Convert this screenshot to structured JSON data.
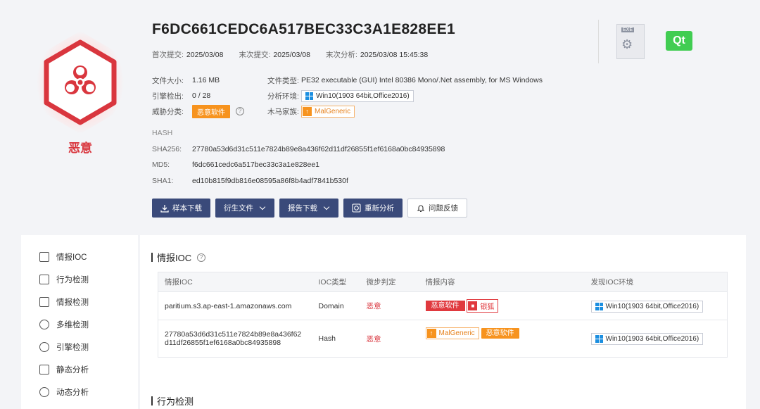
{
  "sample": {
    "hash_title": "F6DC661CEDC6A517BEC33C3A1E828EE1",
    "verdict": "恶意"
  },
  "dates": [
    {
      "label": "首次提交:",
      "value": "2025/03/08"
    },
    {
      "label": "末次提交:",
      "value": "2025/03/08"
    },
    {
      "label": "末次分析:",
      "value": "2025/03/08 15:45:38"
    }
  ],
  "info": {
    "file_size_label": "文件大小:",
    "file_size": "1.16 MB",
    "file_type_label": "文件类型:",
    "file_type": "PE32 executable (GUI) Intel 80386 Mono/.Net assembly, for MS Windows",
    "engine_label": "引擎检出:",
    "engine": "0 / 28",
    "env_label": "分析环境:",
    "env": "Win10(1903 64bit,Office2016)",
    "threat_label": "威胁分类:",
    "threat": "恶意软件",
    "family_label": "木马家族:",
    "family": "MalGeneric"
  },
  "hashes": {
    "title": "HASH",
    "sha256_label": "SHA256:",
    "sha256": "27780a53d6d31c511e7824b89e8a436f62d11df26855f1ef6168a0bc84935898",
    "md5_label": "MD5:",
    "md5": "f6dc661cedc6a517bec33c3a1e828ee1",
    "sha1_label": "SHA1:",
    "sha1": "ed10b815f9db816e08595a86f8b4adf7841b530f"
  },
  "actions": {
    "download": "样本下载",
    "derived": "衍生文件",
    "report": "报告下载",
    "reanalyze": "重新分析",
    "feedback": "问题反馈"
  },
  "file_icons": {
    "exe_tag": "EXE"
  },
  "sidebar": [
    {
      "label": "情报IOC",
      "icon": "edit-icon"
    },
    {
      "label": "行为检测",
      "icon": "monitor-icon"
    },
    {
      "label": "情报检测",
      "icon": "grid-icon"
    },
    {
      "label": "多维检测",
      "icon": "layers-icon"
    },
    {
      "label": "引擎检测",
      "icon": "engine-icon"
    },
    {
      "label": "静态分析",
      "icon": "list-icon"
    },
    {
      "label": "动态分析",
      "icon": "cycle-icon"
    }
  ],
  "ioc": {
    "title": "情报IOC",
    "columns": [
      "情报IOC",
      "IOC类型",
      "微步判定",
      "情报内容",
      "发现IOC环境"
    ],
    "rows": [
      {
        "ioc": "paritium.s3.ap-east-1.amazonaws.com",
        "ioc2": "",
        "type": "Domain",
        "verdict": "恶意",
        "tag1": "恶意软件",
        "tag2": "银狐",
        "env": "Win10(1903 64bit,Office2016)"
      },
      {
        "ioc": "27780a53d6d31c511e7824b89e8a436f62",
        "ioc2": "d11df26855f1ef6168a0bc84935898",
        "type": "Hash",
        "verdict": "恶意",
        "tag1": "MalGeneric",
        "tag2": "恶意软件",
        "env": "Win10(1903 64bit,Office2016)"
      }
    ]
  },
  "behavior": {
    "title": "行为检测"
  }
}
